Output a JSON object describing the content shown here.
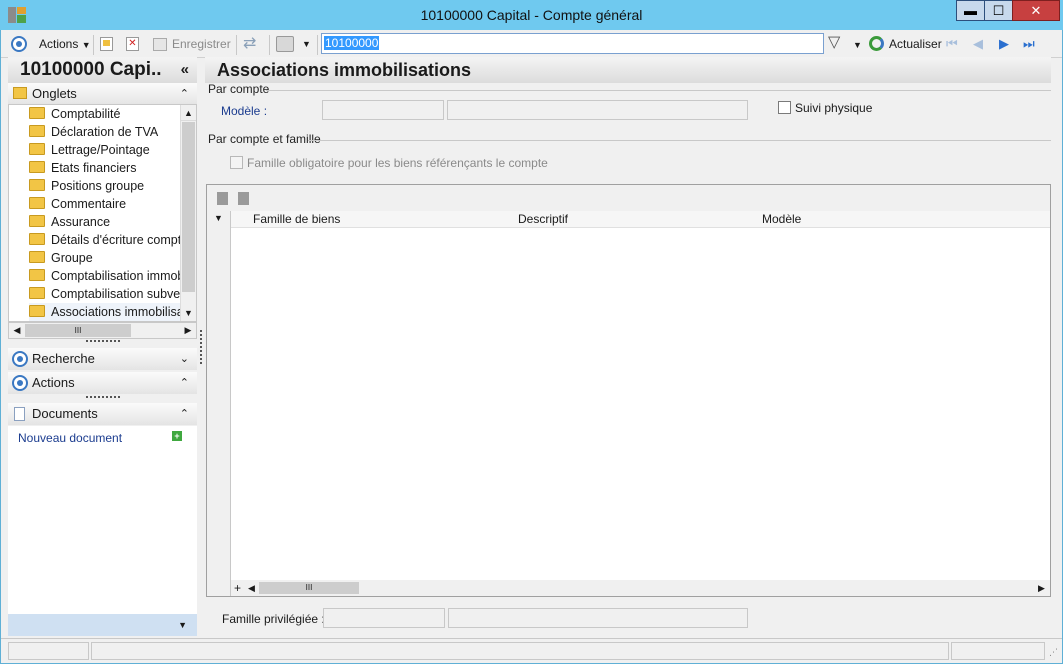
{
  "window": {
    "title": "10100000 Capital -  Compte général",
    "min_label": "▬",
    "max_label": "☐",
    "close_label": "✕"
  },
  "toolbar": {
    "actions_label": "Actions",
    "save_label": "Enregistrer",
    "search_value": "10100000",
    "refresh_label": "Actualiser"
  },
  "left_panel": {
    "title": "10100000 Capi..",
    "collapse_glyph": "«",
    "onglets_label": "Onglets",
    "tree_items": [
      {
        "label": "Comptabilité"
      },
      {
        "label": "Déclaration de TVA"
      },
      {
        "label": "Lettrage/Pointage"
      },
      {
        "label": "Etats financiers"
      },
      {
        "label": "Positions groupe"
      },
      {
        "label": "Commentaire"
      },
      {
        "label": "Assurance"
      },
      {
        "label": "Détails d'écriture compta"
      },
      {
        "label": "Groupe"
      },
      {
        "label": "Comptabilisation immob"
      },
      {
        "label": "Comptabilisation subver"
      },
      {
        "label": "Associations immobilisat"
      }
    ],
    "hscroll_grip": "III",
    "recherche_label": "Recherche",
    "actions_label": "Actions",
    "documents_label": "Documents",
    "new_document_label": "Nouveau document"
  },
  "main": {
    "title": "Associations immobilisations",
    "par_compte_label": "Par compte",
    "modele_label": "Modèle :",
    "suivi_physique_label": "Suivi physique",
    "par_compte_famille_label": "Par compte et famille",
    "famille_obligatoire_label": "Famille obligatoire pour les biens référençants le compte",
    "grid": {
      "columns": [
        "Famille de biens",
        "Descriptif",
        "Modèle"
      ],
      "rows": [],
      "hscroll_grip": "III"
    },
    "famille_privilegiee_label": "Famille privilégiée :"
  },
  "colors": {
    "titlebar": "#6fc9ef",
    "accent_blue": "#3a78c2",
    "close_red": "#c74040",
    "folder_yellow": "#f2c545"
  }
}
